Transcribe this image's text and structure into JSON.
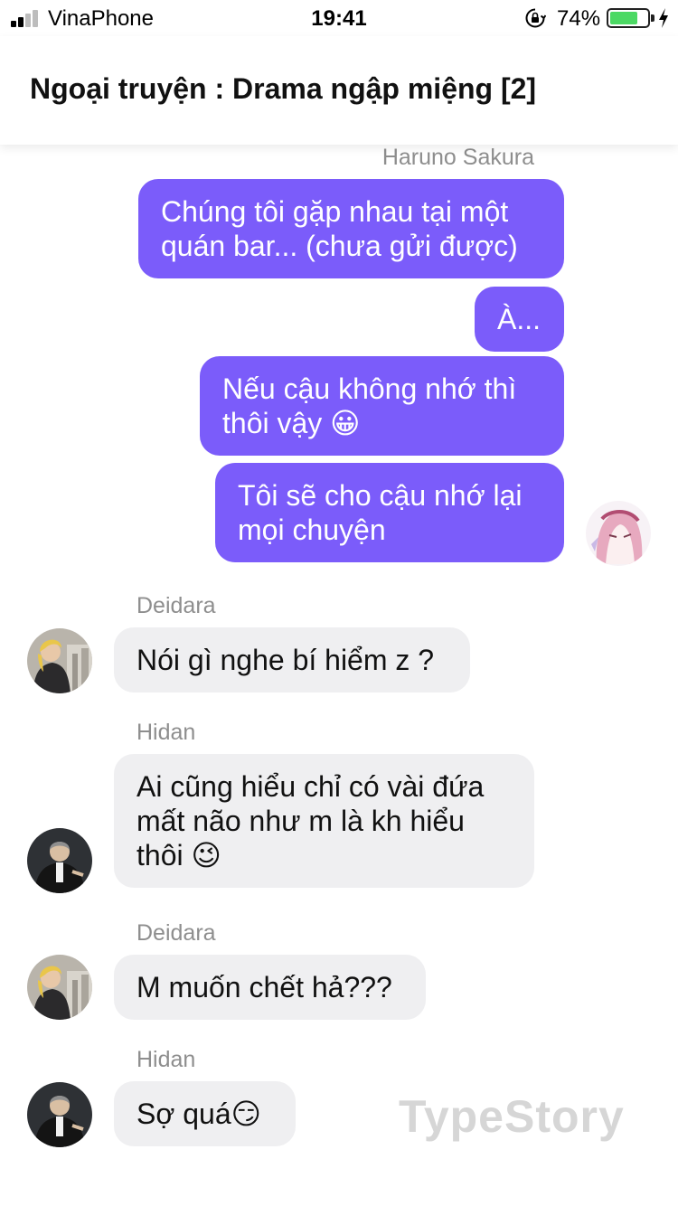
{
  "status_bar": {
    "carrier": "VinaPhone",
    "time": "19:41",
    "battery_percent": "74%",
    "battery_level": 0.74,
    "icons": [
      "signal-icon",
      "orientation-lock-icon",
      "battery-icon",
      "charging-bolt-icon"
    ]
  },
  "header": {
    "title": "Ngoại truyện : Drama ngập miệng [2]"
  },
  "colors": {
    "outgoing_bubble": "#7b5cfa",
    "incoming_bubble": "#efeff1",
    "battery_fill": "#4cd964"
  },
  "messages": [
    {
      "sender": "Haruno Sakura",
      "direction": "outgoing",
      "lines": [
        "Chúng tôi gặp nhau tại một",
        "quán bar... (chưa gửi được)"
      ]
    },
    {
      "sender": "Haruno Sakura",
      "direction": "outgoing",
      "lines": [
        "À..."
      ]
    },
    {
      "sender": "Haruno Sakura",
      "direction": "outgoing",
      "lines": [
        "Nếu cậu không nhớ thì",
        "thôi vậy 😀"
      ]
    },
    {
      "sender": "Haruno Sakura",
      "direction": "outgoing",
      "lines": [
        "Tôi sẽ cho cậu nhớ lại",
        "mọi chuyện"
      ]
    },
    {
      "sender": "Deidara",
      "direction": "incoming",
      "lines": [
        "Nói gì nghe bí hiểm z ?"
      ]
    },
    {
      "sender": "Hidan",
      "direction": "incoming",
      "lines": [
        "Ai cũng hiểu chỉ có vài đứa",
        "mất não như m là kh hiểu",
        "thôi 😉"
      ]
    },
    {
      "sender": "Deidara",
      "direction": "incoming",
      "lines": [
        "M muốn chết hả???"
      ]
    },
    {
      "sender": "Hidan",
      "direction": "incoming",
      "lines": [
        "Sợ quá😏"
      ]
    }
  ],
  "watermark": "TypeStory"
}
